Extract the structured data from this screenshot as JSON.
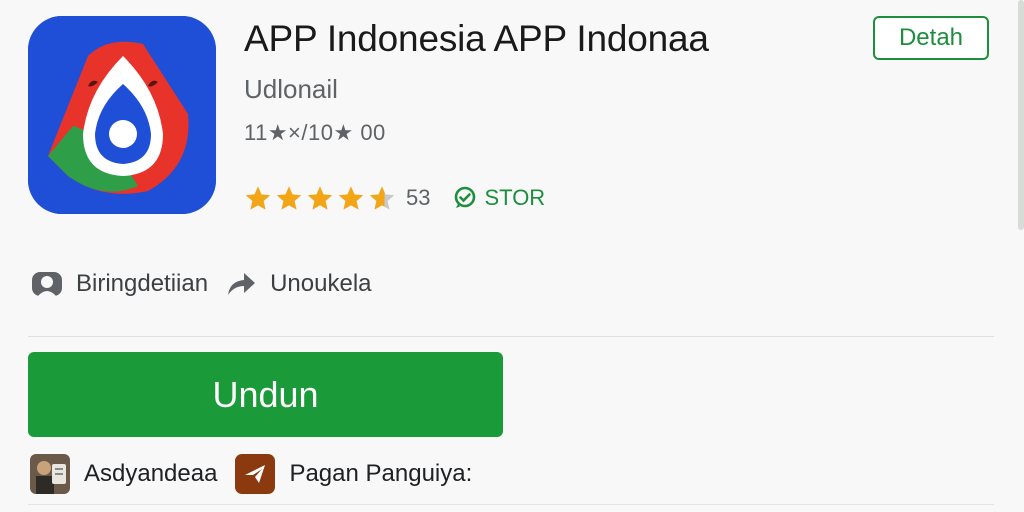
{
  "app": {
    "title": "APP Indonesia APP Indonaa",
    "developer": "Udlonail",
    "meta": "11★×/10★ 00",
    "icon": "app-logo-drop-icon"
  },
  "header": {
    "detail_label": "Detah"
  },
  "rating": {
    "stars": 4.5,
    "count": "53",
    "store_label": "STOR"
  },
  "info": {
    "item1_label": "Biringdetiian",
    "item1_icon": "person-icon",
    "item2_label": "Unoukela",
    "item2_icon": "share-arrow-icon"
  },
  "install": {
    "label": "Undun"
  },
  "bottom": {
    "item1_label": "Asdyandeaa",
    "item2_label": "Pagan Panguiya:"
  },
  "colors": {
    "accent": "#1b9a3a",
    "icon_bg": "#1f4fd6",
    "star": "#f2a516"
  }
}
